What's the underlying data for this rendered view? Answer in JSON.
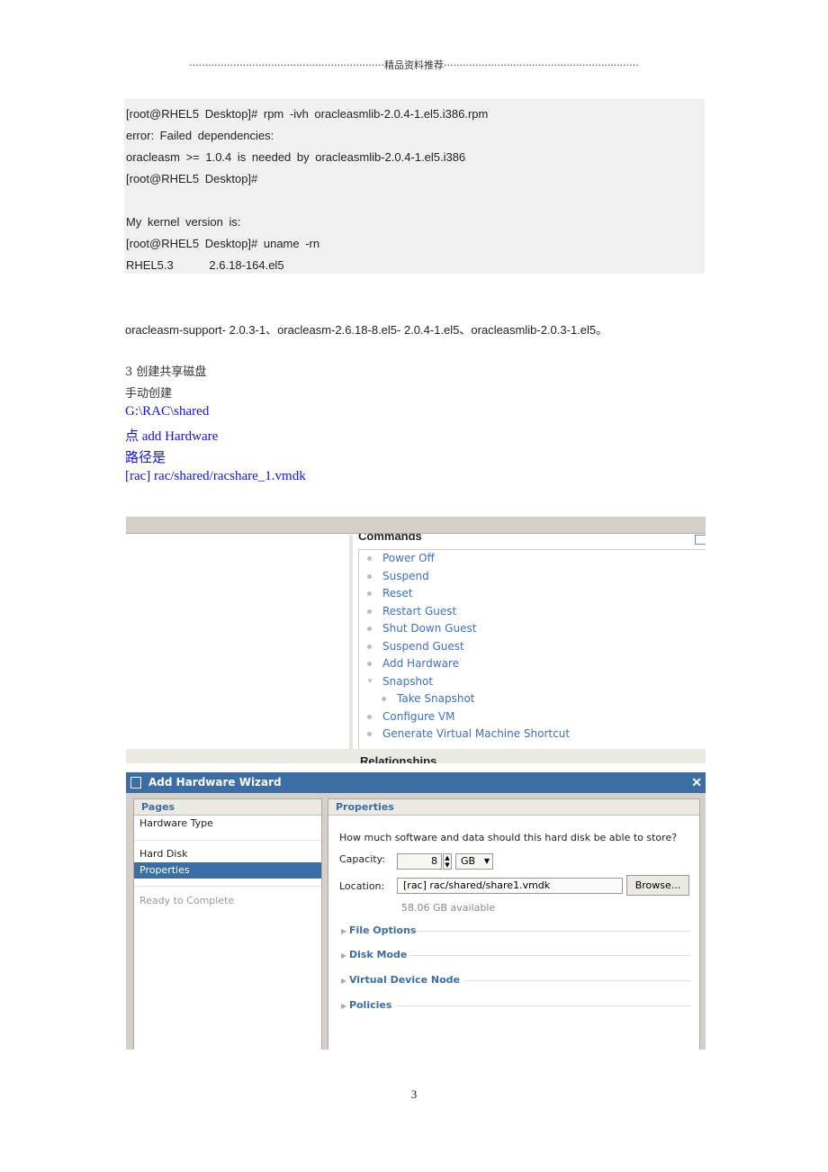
{
  "header": "······························································精品资料推荐······························································",
  "code_lines": [
    "[root@RHEL5 Desktop]# rpm -ivh oracleasmlib-2.0.4-1.el5.i386.rpm",
    "error: Failed dependencies:",
    "oracleasm >= 1.0.4 is needed by oracleasmlib-2.0.4-1.el5.i386",
    "[root@RHEL5 Desktop]#",
    "",
    "My kernel version is:",
    "[root@RHEL5 Desktop]# uname -rn",
    "RHEL5.3      2.6.18-164.el5"
  ],
  "packages": "oracleasm-support- 2.0.3-1、oracleasm-2.6.18-8.el5- 2.0.4-1.el5、oracleasmlib-2.0.3-1.el5。",
  "section": [
    "3 创建共享磁盘",
    "手动创建"
  ],
  "blue_lines": [
    "G:\\RAC\\shared",
    "点 add Hardware",
    "路径是",
    "[rac] rac/shared/racshare_1.vmdk"
  ],
  "screenshot1": {
    "commands_title": "Commands",
    "commands": [
      "Power Off",
      "Suspend",
      "Reset",
      "Restart Guest",
      "Shut Down Guest",
      "Suspend Guest",
      "Add Hardware",
      "Snapshot",
      "Take Snapshot",
      "Configure VM",
      "Generate Virtual Machine Shortcut"
    ],
    "relationships_title": "Relationships"
  },
  "wizard": {
    "title": "Add Hardware Wizard",
    "pages_title": "Pages",
    "pages": [
      "Hardware Type",
      "Hard Disk",
      "Properties",
      "Ready to Complete"
    ],
    "properties_title": "Properties",
    "question": "How much software and data should this hard disk be able to store?",
    "capacity_label": "Capacity:",
    "capacity_value": "8",
    "capacity_unit": "GB",
    "location_label": "Location:",
    "location_value": "[rac] rac/shared/share1.vmdk",
    "browse": "Browse...",
    "available": "58.06 GB available",
    "sections": [
      "File Options",
      "Disk Mode",
      "Virtual Device Node",
      "Policies"
    ],
    "accent": "#3a6ea5"
  },
  "page_number": "3"
}
